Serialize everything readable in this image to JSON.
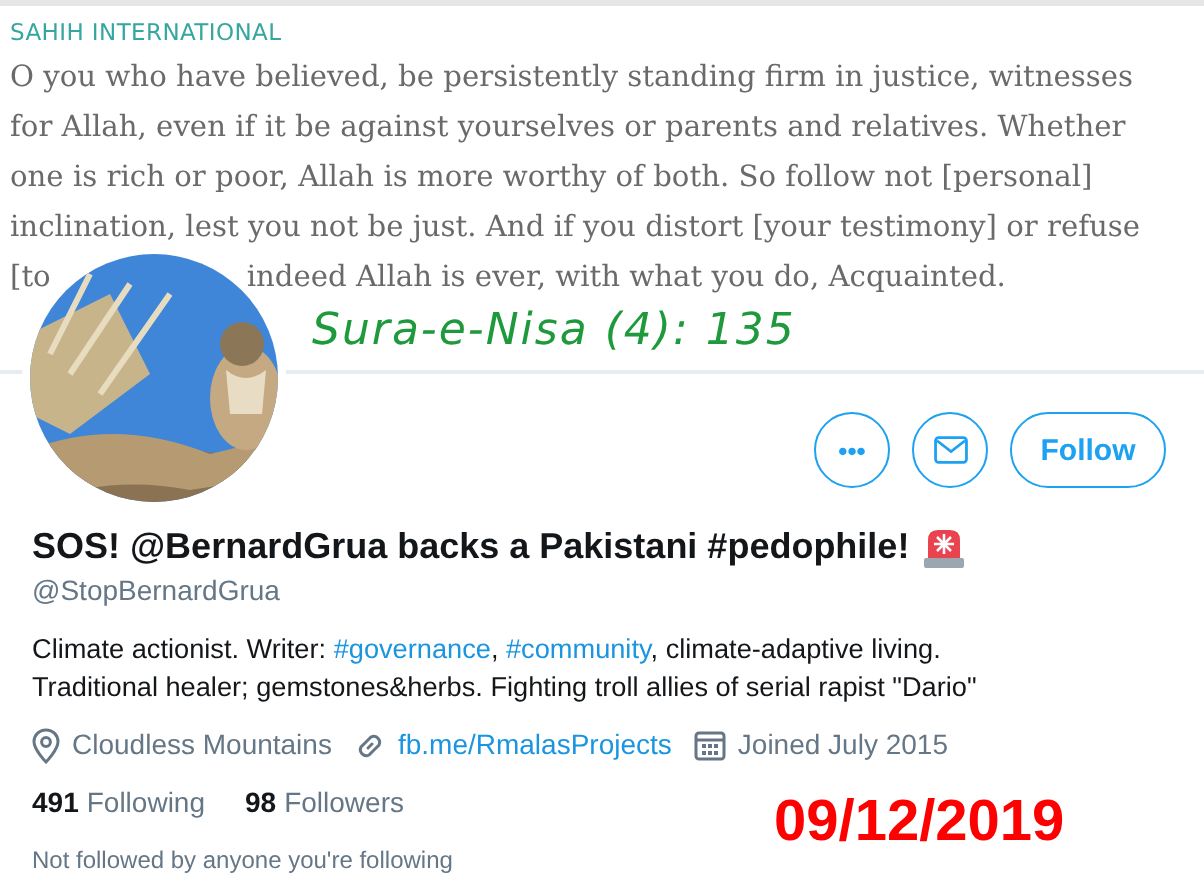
{
  "banner": {
    "source_label": "SAHIH INTERNATIONAL",
    "verse_lines": [
      "O you who have believed, be persistently standing firm in justice, witnesses",
      "for Allah, even if it be against yourselves or parents and relatives. Whether",
      "one is rich or poor, Allah is more worthy of both. So follow not [personal]",
      "inclination, lest you not be just. And if you distort [your testimony] or refuse"
    ],
    "verse_last_line": {
      "before_avatar": "[to",
      "after_avatar": "indeed Allah is ever, with what you do, Acquainted."
    },
    "handwritten_note": "Sura-e-Nisa (4): 135"
  },
  "actions": [
    {
      "kind": "more",
      "label": "•••"
    },
    {
      "kind": "message"
    },
    {
      "kind": "follow",
      "label": "Follow"
    }
  ],
  "profile": {
    "name": "SOS! @BernardGrua backs a Pakistani #pedophile!",
    "handle": "@StopBernardGrua",
    "bio_lines": [
      [
        {
          "kind": "text",
          "text": "Climate actionist. Writer: "
        },
        {
          "kind": "hashtag",
          "text": "#governance"
        },
        {
          "kind": "text",
          "text": ", "
        },
        {
          "kind": "hashtag",
          "text": "#community"
        },
        {
          "kind": "text",
          "text": ", climate-adaptive living."
        }
      ],
      [
        {
          "kind": "text",
          "text": "Traditional healer; gemstones&herbs. Fighting troll allies of serial rapist \"Dario\""
        }
      ]
    ],
    "meta": [
      {
        "kind": "location",
        "text": "Cloudless Mountains"
      },
      {
        "kind": "link",
        "text": "fb.me/RmalasProjects"
      },
      {
        "kind": "joined",
        "text": "Joined July 2015"
      }
    ],
    "stats": [
      {
        "count": "491",
        "label": "Following"
      },
      {
        "count": "98",
        "label": "Followers"
      }
    ],
    "followed_by_note": "Not followed by anyone you're following"
  },
  "date_stamp": "09/12/2019"
}
